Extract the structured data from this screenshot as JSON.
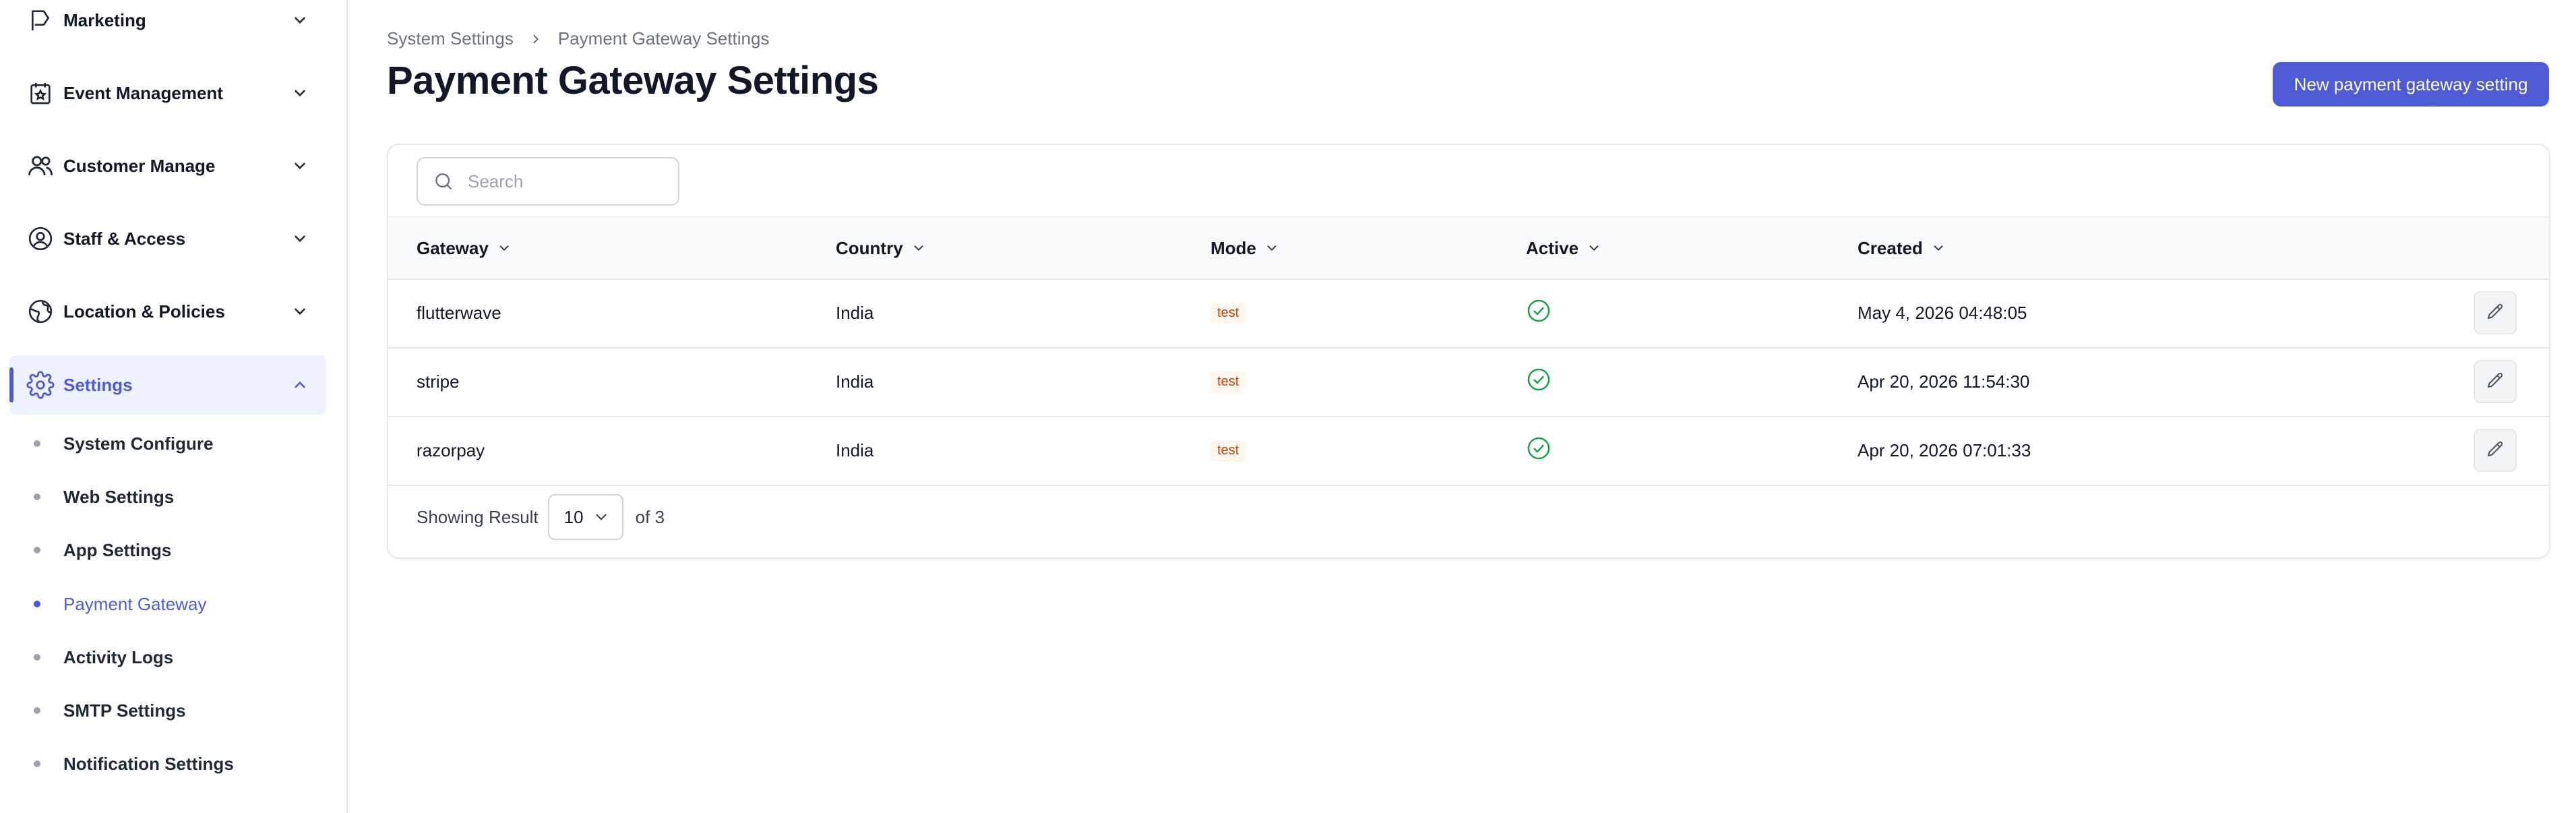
{
  "sidebar": {
    "groups": [
      {
        "label": "Marketing",
        "icon": "flag-icon"
      },
      {
        "label": "Event Management",
        "icon": "calendar-star-icon"
      },
      {
        "label": "Customer Manage",
        "icon": "users-icon"
      },
      {
        "label": "Staff & Access",
        "icon": "user-circle-icon"
      },
      {
        "label": "Location & Policies",
        "icon": "globe-icon"
      },
      {
        "label": "Settings",
        "icon": "gear-icon"
      }
    ],
    "sub_items": [
      {
        "label": "System Configure"
      },
      {
        "label": "Web Settings"
      },
      {
        "label": "App Settings"
      },
      {
        "label": "Payment Gateway"
      },
      {
        "label": "Activity Logs"
      },
      {
        "label": "SMTP Settings"
      },
      {
        "label": "Notification Settings"
      }
    ],
    "active_group": "Settings",
    "active_item": "Payment Gateway"
  },
  "breadcrumb": {
    "items": [
      "System Settings",
      "Payment Gateway Settings"
    ]
  },
  "page": {
    "title": "Payment Gateway Settings",
    "new_button": "New payment gateway setting"
  },
  "search": {
    "placeholder": "Search",
    "value": ""
  },
  "table": {
    "columns": [
      "Gateway",
      "Country",
      "Mode",
      "Active",
      "Created"
    ],
    "rows": [
      {
        "gateway": "flutterwave",
        "country": "India",
        "mode": "test",
        "active": true,
        "created": "May 4, 2026 04:48:05"
      },
      {
        "gateway": "stripe",
        "country": "India",
        "mode": "test",
        "active": true,
        "created": "Apr 20, 2026 11:54:30"
      },
      {
        "gateway": "razorpay",
        "country": "India",
        "mode": "test",
        "active": true,
        "created": "Apr 20, 2026 07:01:33"
      }
    ]
  },
  "pagination": {
    "prefix": "Showing Result",
    "page_size": "10",
    "suffix": "of 3"
  },
  "colors": {
    "accent": "#4f5bd5",
    "success": "#16a34a",
    "badge_text": "#c2410c",
    "badge_bg": "#fff7ed"
  }
}
